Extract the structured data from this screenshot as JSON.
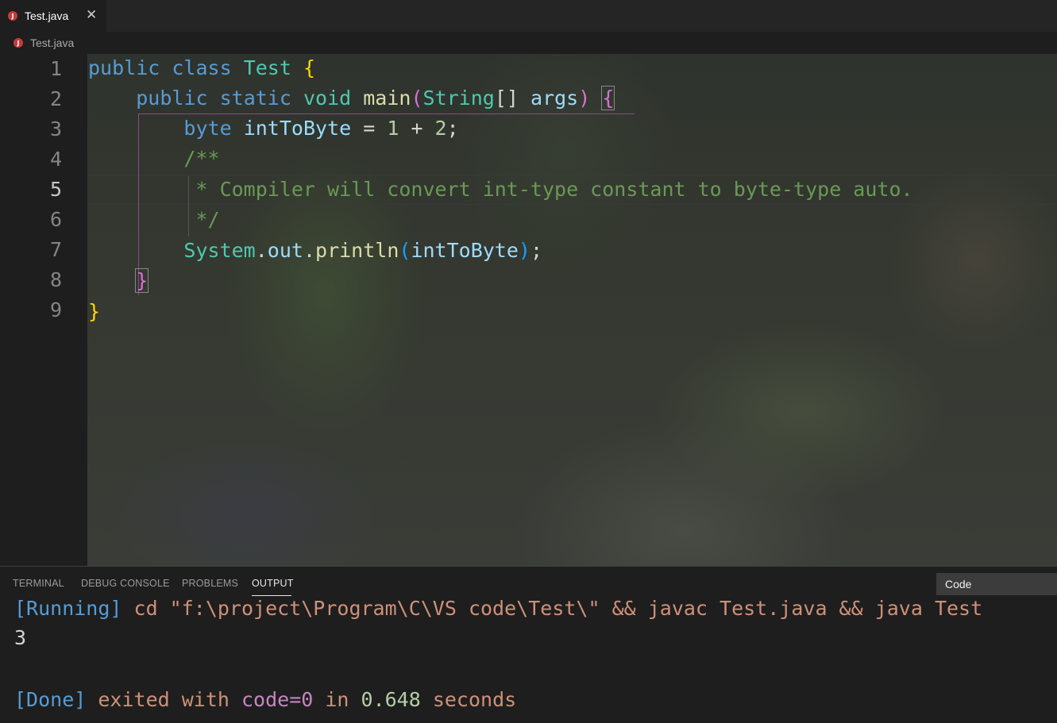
{
  "tab": {
    "label": "Test.java",
    "close": "✕",
    "icon": "J"
  },
  "breadcrumb": {
    "label": "Test.java",
    "icon": "J"
  },
  "gutter": {
    "lines": [
      "1",
      "2",
      "3",
      "4",
      "5",
      "6",
      "7",
      "8",
      "9"
    ],
    "active_line": "5"
  },
  "code": {
    "l1": {
      "kw1": "public",
      "kw2": "class",
      "cls": "Test",
      "brace": "{"
    },
    "l2": {
      "kw1": "public",
      "kw2": "static",
      "kw3": "void",
      "fn": "main",
      "paren_open": "(",
      "type": "String",
      "arr": "[]",
      "arg": "args",
      "paren_close": ")",
      "brace": "{"
    },
    "l3": {
      "kw": "byte",
      "var": "intToByte",
      "eq": " = ",
      "n1": "1",
      "plus": " + ",
      "n2": "2",
      "semi": ";"
    },
    "l4": {
      "comment": "/**"
    },
    "l5": {
      "comment": " * Compiler will convert int-type constant to byte-type auto."
    },
    "l6": {
      "comment": " */"
    },
    "l7": {
      "cls": "System",
      "dot1": ".",
      "field": "out",
      "dot2": ".",
      "fn": "println",
      "paren_open": "(",
      "arg": "intToByte",
      "paren_close": ")",
      "semi": ";"
    },
    "l8": {
      "brace": "}"
    },
    "l9": {
      "brace": "}"
    }
  },
  "panel": {
    "tabs": [
      "TERMINAL",
      "DEBUG CONSOLE",
      "PROBLEMS",
      "OUTPUT"
    ],
    "active_tab": "OUTPUT",
    "select_value": "Code",
    "output": {
      "running_tag": "[Running]",
      "command": " cd \"f:\\project\\Program\\C\\VS code\\Test\\\" && javac Test.java && java Test",
      "result": "3",
      "done_tag": "[Done]",
      "exited": " exited with ",
      "code_label": "code=0",
      "in": " in ",
      "time": "0.648",
      "seconds": " seconds"
    }
  },
  "colors": {
    "keyword": "#569cd6",
    "type": "#4ec9b0",
    "function": "#dcdcaa",
    "variable": "#9cdcfe",
    "number": "#b5cea8",
    "comment": "#6a9955",
    "bracket1": "#ffd700",
    "bracket2": "#da70d6"
  }
}
